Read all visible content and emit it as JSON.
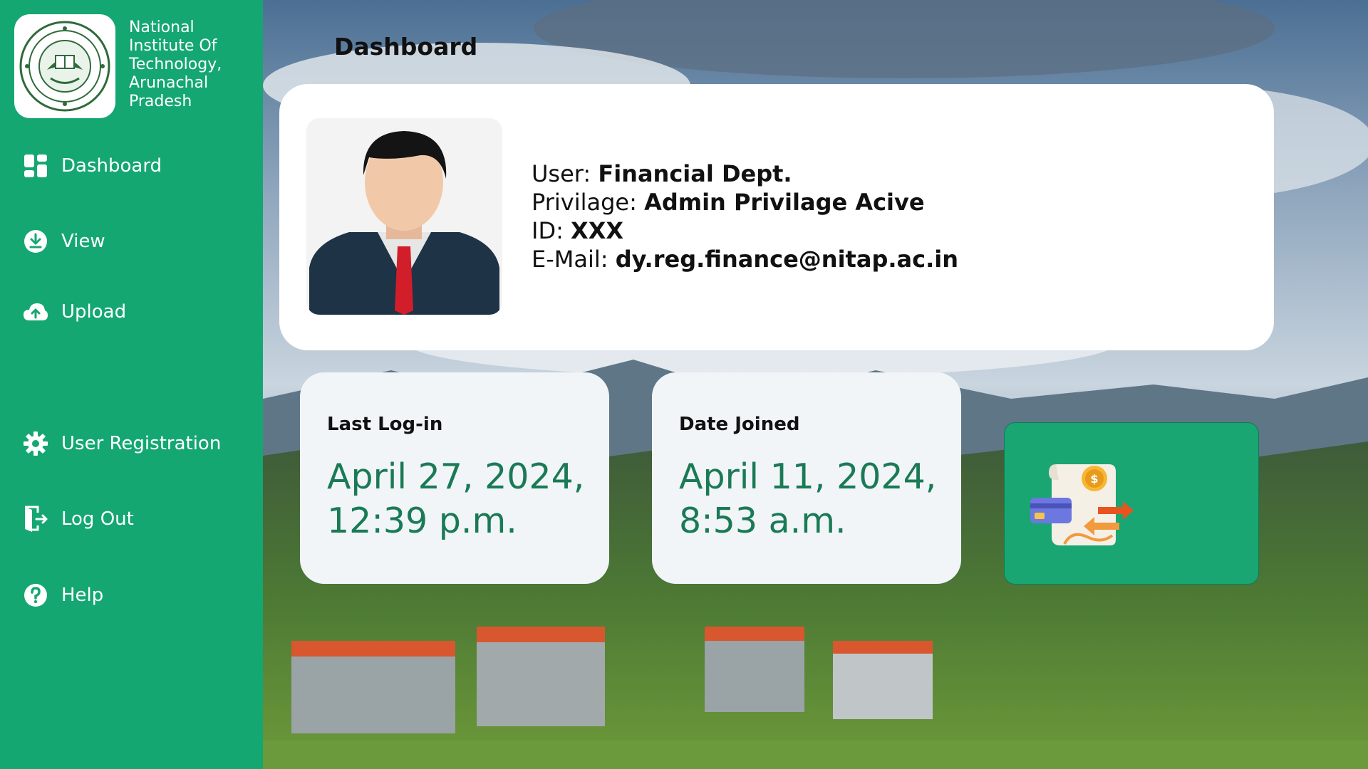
{
  "institute": {
    "name_lines": [
      "National",
      "Institute Of",
      "Technology,",
      "Arunachal",
      "Pradesh"
    ]
  },
  "sidebar": {
    "items": [
      {
        "label": "Dashboard",
        "icon": "dashboard-grid-icon"
      },
      {
        "label": "View",
        "icon": "download-circle-icon"
      },
      {
        "label": "Upload",
        "icon": "cloud-upload-icon"
      },
      {
        "label": "User Registration",
        "icon": "gear-icon"
      },
      {
        "label": "Log Out",
        "icon": "logout-door-icon"
      },
      {
        "label": "Help",
        "icon": "help-circle-icon"
      }
    ]
  },
  "header": {
    "title": "Dashboard"
  },
  "profile": {
    "user_label": "User:",
    "user_value": "Financial Dept.",
    "privilege_label": "Privilage:",
    "privilege_value": "Admin Privilage Acive",
    "id_label": "ID:",
    "id_value": "XXX",
    "email_label": "E-Mail:",
    "email_value": "dy.reg.finance@nitap.ac.in"
  },
  "stats": {
    "last_login": {
      "label": "Last Log-in",
      "line1": "April 27, 2024,",
      "line2": "12:39 p.m."
    },
    "date_joined": {
      "label": "Date Joined",
      "line1": "April 11, 2024,",
      "line2": "8:53 a.m."
    }
  },
  "finance_tile": {
    "icon": "finance-transaction-icon"
  },
  "colors": {
    "sidebar": "#14a772",
    "accent_text": "#1a7a55",
    "tile": "#19a672"
  }
}
